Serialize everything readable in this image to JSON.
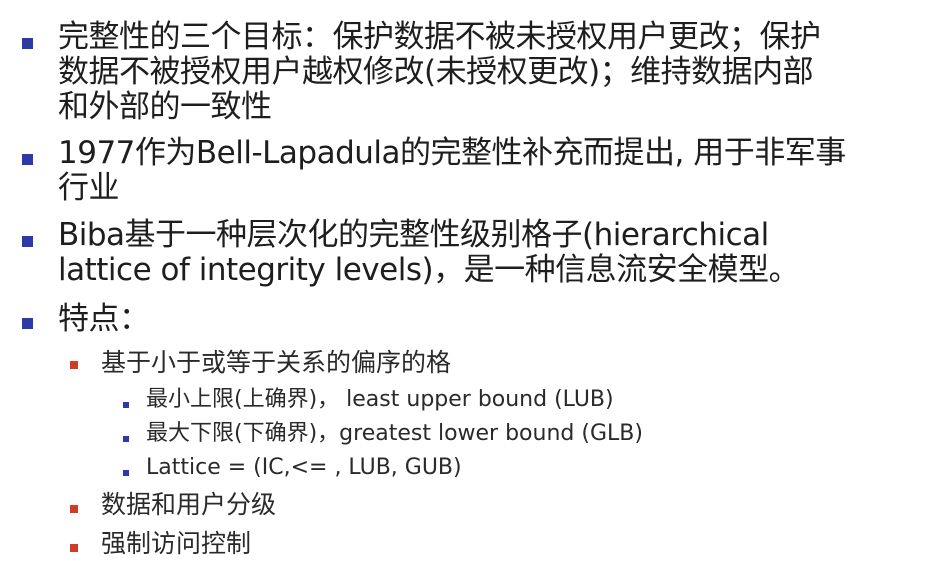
{
  "slide": {
    "items": [
      {
        "level": 1,
        "lines": [
          "完整性的三个目标：保护数据不被未授权用户更改；保护",
          "数据不被授权用户越权修改(未授权更改)；维持数据内部",
          "和外部的一致性"
        ]
      },
      {
        "level": 1,
        "lines": [
          "1977作为Bell-Lapadula的完整性补充而提出, 用于非军事",
          "行业"
        ]
      },
      {
        "level": 1,
        "lines": [
          "Biba基于一种层次化的完整性级别格子(hierarchical",
          "lattice of integrity levels)，是一种信息流安全模型。"
        ]
      },
      {
        "level": 1,
        "lines": [
          "特点："
        ]
      },
      {
        "level": 2,
        "lines": [
          "基于小于或等于关系的偏序的格"
        ]
      },
      {
        "level": 3,
        "lines": [
          "最小上限(上确界)，  least upper bound (LUB)"
        ]
      },
      {
        "level": 3,
        "lines": [
          "最大下限(下确界)，greatest lower bound (GLB)"
        ]
      },
      {
        "level": 3,
        "lines": [
          "Lattice = (IC,<= , LUB, GUB)"
        ]
      },
      {
        "level": 2,
        "lines": [
          "数据和用户分级"
        ]
      },
      {
        "level": 2,
        "lines": [
          "强制访问控制"
        ]
      }
    ]
  },
  "bullet_colors": {
    "level1": "#2c39a6",
    "level2": "#d13c26",
    "level3": "#2c39a6"
  }
}
